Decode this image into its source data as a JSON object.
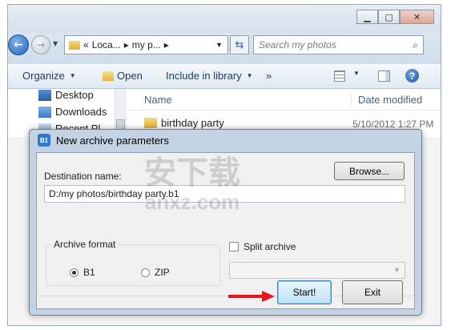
{
  "explorer": {
    "address": {
      "separator_glyph": "«",
      "crumbs": [
        "Loca...",
        "my p..."
      ]
    },
    "search_placeholder": "Search my photos",
    "toolbar": {
      "organize": "Organize",
      "open": "Open",
      "include_in_library": "Include in library",
      "more": "»"
    },
    "nav_pane": [
      {
        "label": "Desktop",
        "icon": "desktop-icon"
      },
      {
        "label": "Downloads",
        "icon": "downloads-icon"
      },
      {
        "label": "Recent Pl",
        "icon": "recent-places-icon"
      }
    ],
    "columns": {
      "name": "Name",
      "date_modified": "Date modified"
    },
    "files": [
      {
        "name": "birthday party",
        "date": "5/10/2012 1:27 PM",
        "icon": "folder-icon"
      }
    ]
  },
  "dialog": {
    "title": "New archive parameters",
    "destination_label": "Destination name:",
    "destination_value": "D:/my photos/birthday party.b1",
    "browse_button": "Browse...",
    "archive_format_label": "Archive format",
    "formats": [
      {
        "label": "B1",
        "selected": true
      },
      {
        "label": "ZIP",
        "selected": false
      }
    ],
    "split_archive_label": "Split archive",
    "split_archive_checked": false,
    "start_button": "Start!",
    "exit_button": "Exit"
  },
  "watermark": {
    "brand": "安下载",
    "domain": "anxz.com"
  },
  "colors": {
    "annotation_arrow": "#e8141a",
    "dialog_frame": "#c4d3e4",
    "default_button": "#bfe0f5"
  }
}
